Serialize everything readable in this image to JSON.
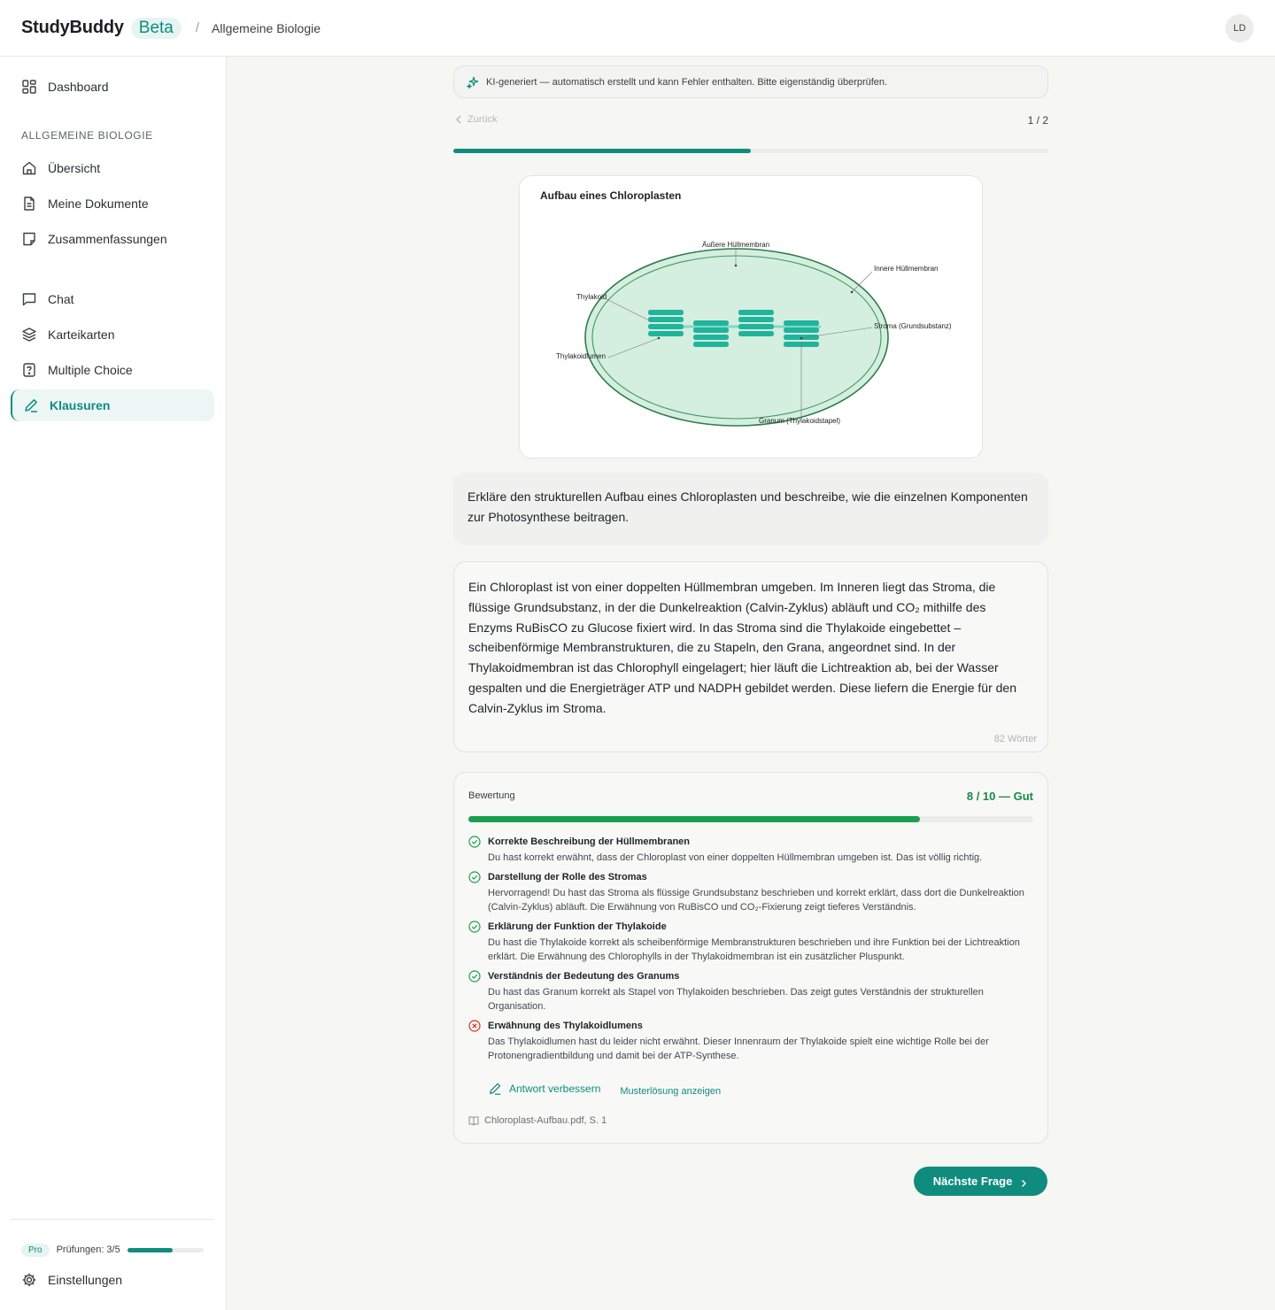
{
  "header": {
    "brand": "StudyBuddy",
    "badge": "Beta",
    "separator": "/",
    "breadcrumb": "Allgemeine Biologie",
    "avatar_initials": "LD"
  },
  "sidebar": {
    "dashboard": "Dashboard",
    "section_label": "ALLGEMEINE BIOLOGIE",
    "items": [
      {
        "label": "Übersicht",
        "icon": "home-icon"
      },
      {
        "label": "Meine Dokumente",
        "icon": "document-icon"
      },
      {
        "label": "Zusammenfassungen",
        "icon": "note-icon"
      },
      {
        "label": "Chat",
        "icon": "chat-icon"
      },
      {
        "label": "Karteikarten",
        "icon": "layers-icon"
      },
      {
        "label": "Multiple Choice",
        "icon": "question-icon"
      },
      {
        "label": "Klausuren",
        "icon": "pen-icon",
        "active": true
      }
    ],
    "plan": {
      "badge": "Pro",
      "usage_text": "Prüfungen: 3/5",
      "usage_fraction": 0.6
    },
    "settings": "Einstellungen"
  },
  "ai_notice": "KI-generiert — automatisch erstellt und kann Fehler enthalten. Bitte eigenständig überprüfen.",
  "nav": {
    "back": "Zurück",
    "counter": "1 / 2",
    "progress_fraction": 0.5
  },
  "figure": {
    "title": "Aufbau eines Chloroplasten",
    "labels": {
      "outer_membrane": "Äußere Hüllmembran",
      "inner_membrane": "Innere Hüllmembran",
      "thylakoid": "Thylakoid",
      "stroma": "Stroma (Grundsubstanz)",
      "thylakoid_lumen": "Thylakoidlumen",
      "granum": "Granum (Thylakoidstapel)"
    }
  },
  "question": "Erkläre den strukturellen Aufbau eines Chloroplasten und beschreibe, wie die einzelnen Komponenten zur Photosynthese beitragen.",
  "answer": {
    "text": "Ein Chloroplast ist von einer doppelten Hüllmembran umgeben. Im Inneren liegt das Stroma, die flüssige Grundsubstanz, in der die Dunkelreaktion (Calvin-Zyklus) abläuft und CO₂ mithilfe des Enzyms RuBisCO zu Glucose fixiert wird. In das Stroma sind die Thylakoide eingebettet – scheibenförmige Membranstrukturen, die zu Stapeln, den Grana, angeordnet sind. In der Thylakoidmembran ist das Chlorophyll eingelagert; hier läuft die Lichtreaktion ab, bei der Wasser gespalten und die Energieträger ATP und NADPH gebildet werden. Diese liefern die Energie für den Calvin-Zyklus im Stroma.",
    "word_count": "82 Wörter"
  },
  "evaluation": {
    "label": "Bewertung",
    "score_text": "8 / 10 — Gut",
    "score_fraction": 0.8,
    "criteria": [
      {
        "status": "ok",
        "title": "Korrekte Beschreibung der Hüllmembranen",
        "desc": "Du hast korrekt erwähnt, dass der Chloroplast von einer doppelten Hüllmembran umgeben ist. Das ist völlig richtig."
      },
      {
        "status": "ok",
        "title": "Darstellung der Rolle des Stromas",
        "desc": "Hervorragend! Du hast das Stroma als flüssige Grundsubstanz beschrieben und korrekt erklärt, dass dort die Dunkelreaktion (Calvin-Zyklus) abläuft. Die Erwähnung von RuBisCO und CO₂-Fixierung zeigt tieferes Verständnis."
      },
      {
        "status": "ok",
        "title": "Erklärung der Funktion der Thylakoide",
        "desc": "Du hast die Thylakoide korrekt als scheibenförmige Membranstrukturen beschrieben und ihre Funktion bei der Lichtreaktion erklärt. Die Erwähnung des Chlorophylls in der Thylakoidmembran ist ein zusätzlicher Pluspunkt."
      },
      {
        "status": "ok",
        "title": "Verständnis der Bedeutung des Granums",
        "desc": "Du hast das Granum korrekt als Stapel von Thylakoiden beschrieben. Das zeigt gutes Verständnis der strukturellen Organisation."
      },
      {
        "status": "missing",
        "title": "Erwähnung des Thylakoidlumens",
        "desc": "Das Thylakoidlumen hast du leider nicht erwähnt. Dieser Innenraum der Thylakoide spielt eine wichtige Rolle bei der Protonengradientbildung und damit bei der ATP-Synthese."
      }
    ],
    "improve_label": "Antwort verbessern",
    "solution_label": "Musterlösung anzeigen",
    "source": "Chloroplast-Aufbau.pdf, S. 1"
  },
  "next_button": "Nächste Frage",
  "colors": {
    "accent": "#0f8c7e",
    "success": "#1a9e50",
    "error": "#d93025"
  }
}
